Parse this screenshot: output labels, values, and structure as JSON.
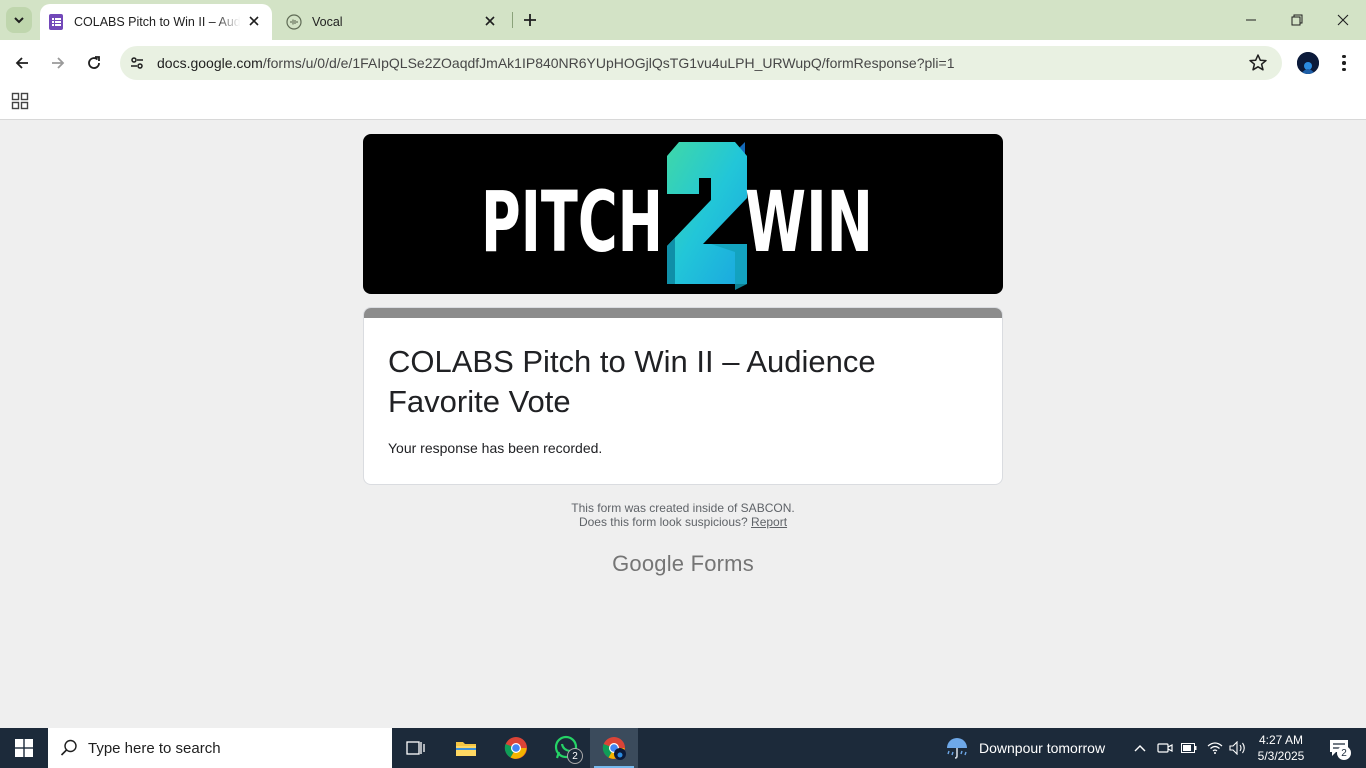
{
  "browser": {
    "tabs": [
      {
        "title": "COLABS Pitch to Win II – Audience Favorite Vote",
        "active": true,
        "icon": "google-forms-icon"
      },
      {
        "title": "Vocal",
        "active": false,
        "icon": "vocal-icon"
      }
    ],
    "url_host": "docs.google.com",
    "url_path": "/forms/u/0/d/e/1FAIpQLSe2ZOaqdfJmAk1IP840NR6YUpHOGjlQsTG1vu4uLPH_URWupQ/formResponse?pli=1",
    "accent_color": "#d3e3c6"
  },
  "banner": {
    "text_left": "PITCH",
    "text_number": "2",
    "text_right": "WIN"
  },
  "form": {
    "title": "COLABS Pitch to Win II – Audience Favorite Vote",
    "confirmation": "Your response has been recorded.",
    "created_note": "This form was created inside of SABCON.",
    "suspicious_prompt": "Does this form look suspicious?",
    "report_link": "Report",
    "brand_google": "Google",
    "brand_forms": "Forms"
  },
  "taskbar": {
    "search_placeholder": "Type here to search",
    "whatsapp_badge": "2",
    "weather_text": "Downpour tomorrow",
    "time": "4:27 AM",
    "date": "5/3/2025",
    "notification_count": "2"
  }
}
